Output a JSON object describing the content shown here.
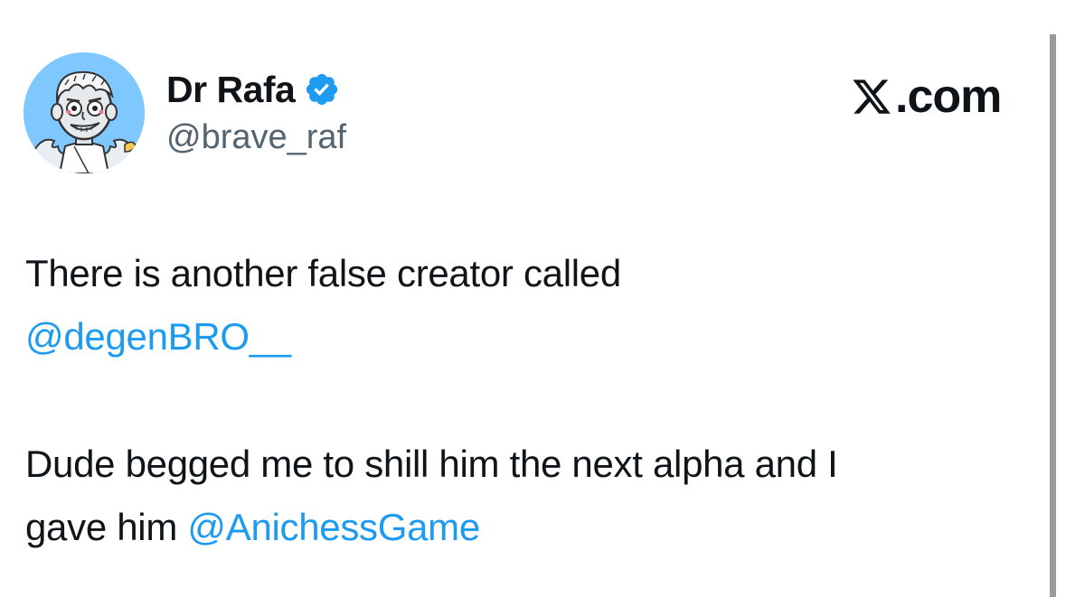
{
  "author": {
    "display_name": "Dr Rafa",
    "handle": "@brave_raf",
    "verified": true,
    "avatar_icon": "cartoon-avatar"
  },
  "brand": {
    "text": "X.com",
    "logo_letter": "X"
  },
  "tweet": {
    "line1_text": "There is another false creator called",
    "line1_mention": "@degenBRO__",
    "line2_text": "Dude begged me to shill him the next alpha and I",
    "line2_text_cont": "gave him ",
    "line2_mention": "@AnichessGame"
  },
  "colors": {
    "mention": "#1d9bf0",
    "verified_badge": "#1d9bf0",
    "handle": "#536471",
    "text": "#0f1419",
    "avatar_bg": "#7fc8ff"
  }
}
